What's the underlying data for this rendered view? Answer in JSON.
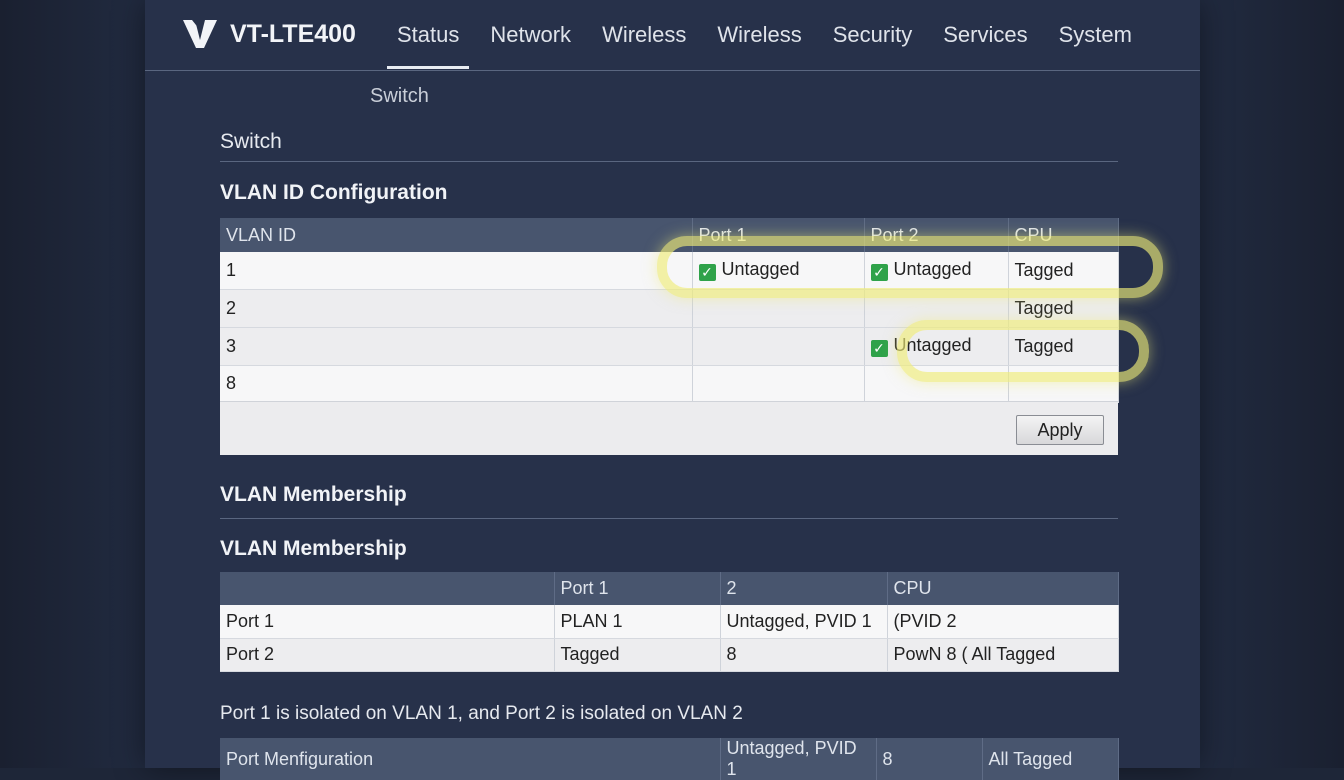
{
  "app": {
    "brand": "VT-LTE400",
    "colors": {
      "accent_highlight": "#f0ec78",
      "check_green": "#2fa24a",
      "header_bg": "#48556e"
    }
  },
  "nav": {
    "items": [
      {
        "label": "Status",
        "active": true
      },
      {
        "label": "Network",
        "active": false
      },
      {
        "label": "Wireless",
        "active": false
      },
      {
        "label": "Wireless",
        "active": false
      },
      {
        "label": "Security",
        "active": false
      },
      {
        "label": "Services",
        "active": false
      },
      {
        "label": "System",
        "active": false
      }
    ],
    "sub": "Switch"
  },
  "page": {
    "title": "Switch"
  },
  "vlan_config": {
    "title": "VLAN ID Configuration",
    "headers": [
      "VLAN ID",
      "Port 1",
      "Port 2",
      "CPU"
    ],
    "rows": [
      {
        "id": "1",
        "port1": "Untagged",
        "port1_checked": true,
        "port2": "Untagged",
        "port2_checked": true,
        "cpu": "Tagged"
      },
      {
        "id": "2",
        "port1": "",
        "port1_checked": false,
        "port2": "",
        "port2_checked": false,
        "cpu": "Tagged"
      },
      {
        "id": "3",
        "port1": "",
        "port1_checked": false,
        "port2": "Untagged",
        "port2_checked": true,
        "cpu": "Tagged"
      },
      {
        "id": "8",
        "port1": "",
        "port1_checked": false,
        "port2": "",
        "port2_checked": false,
        "cpu": ""
      }
    ],
    "apply_label": "Apply"
  },
  "membership": {
    "title_1": "VLAN Membership",
    "title_2": "VLAN Membership",
    "headers": [
      "",
      "Port 1",
      "2",
      "CPU"
    ],
    "rows": [
      [
        "Port 1",
        "PLAN 1",
        "Untagged, PVID 1",
        "(PVID 2"
      ],
      [
        "Port 2",
        "Tagged",
        "8",
        "PowN 8 ( All Tagged"
      ]
    ]
  },
  "note": "Port 1 is isolated on VLAN 1, and Port 2 is isolated on VLAN 2",
  "port_config": {
    "headers": [
      "Port Menfiguration",
      "Untagged, PVID 1",
      "8",
      "All Tagged"
    ]
  }
}
